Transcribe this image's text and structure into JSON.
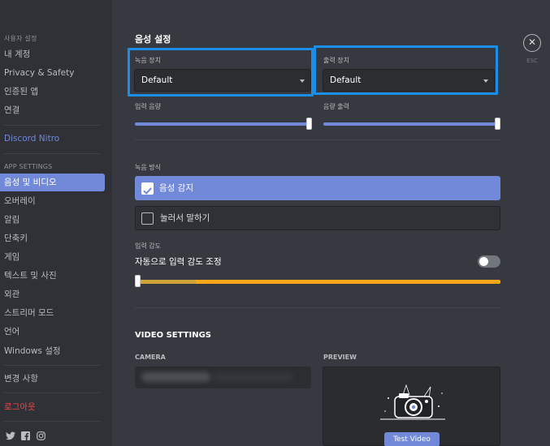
{
  "sidebar": {
    "user_settings_header": "사용자 설정",
    "user_items": [
      "내 계정",
      "Privacy & Safety",
      "인증된 앱",
      "연결"
    ],
    "nitro": "Discord Nitro",
    "app_settings_header": "APP SETTINGS",
    "app_items": [
      {
        "label": "음성 및 비디오",
        "active": true
      },
      {
        "label": "오버레이",
        "active": false
      },
      {
        "label": "알림",
        "active": false
      },
      {
        "label": "단축키",
        "active": false
      },
      {
        "label": "게임",
        "active": false
      },
      {
        "label": "텍스트 및 사진",
        "active": false
      },
      {
        "label": "외관",
        "active": false
      },
      {
        "label": "스트리머 모드",
        "active": false
      },
      {
        "label": "언어",
        "active": false
      },
      {
        "label": "Windows 설정",
        "active": false
      }
    ],
    "changelog": "변경 사항",
    "logout": "로그아웃",
    "socials": [
      "twitter-icon",
      "facebook-icon",
      "instagram-icon"
    ]
  },
  "voice": {
    "title": "음성 설정",
    "input_device_label": "녹음 장치",
    "input_device_value": "Default",
    "output_device_label": "출력 장치",
    "output_device_value": "Default",
    "input_volume_label": "입력 음량",
    "input_volume": 100,
    "output_volume_label": "음량 출력",
    "output_volume": 100,
    "input_mode_label": "녹음 방식",
    "mode_voice_activity": "음성 감지",
    "mode_push_to_talk": "눌러서 말하기",
    "selected_mode": "voice_activity",
    "sensitivity_label": "입력 감도",
    "auto_sensitivity_label": "자동으로 입력 감도 조정",
    "auto_sensitivity_on": false
  },
  "video": {
    "title": "VIDEO SETTINGS",
    "camera_label": "CAMERA",
    "preview_label": "PREVIEW",
    "test_video_button": "Test Video"
  },
  "close": {
    "esc_label": "ESC",
    "icon": "close-icon"
  },
  "colors": {
    "accent": "#7289da",
    "highlight": "#1b8ee8",
    "sensitivity": "#faa61a",
    "logout": "#f04747"
  }
}
